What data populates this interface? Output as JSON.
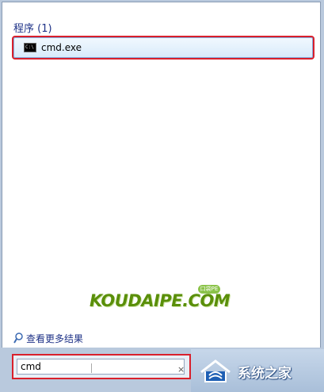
{
  "results": {
    "group_label": "程序 (1)",
    "items": [
      {
        "label": "cmd.exe",
        "icon": "command-prompt-icon"
      }
    ]
  },
  "watermark": {
    "text": "KOUDAIPE.COM",
    "badge": "口袋PE"
  },
  "see_more": {
    "label": "查看更多结果",
    "icon": "search-icon"
  },
  "search": {
    "value": "cmd",
    "clear_glyph": "×"
  },
  "logo": {
    "text": "系统之家"
  },
  "colors": {
    "highlight_border": "#d9202c",
    "link_blue": "#1e3287",
    "selection_bg": "#d8ebfb"
  }
}
